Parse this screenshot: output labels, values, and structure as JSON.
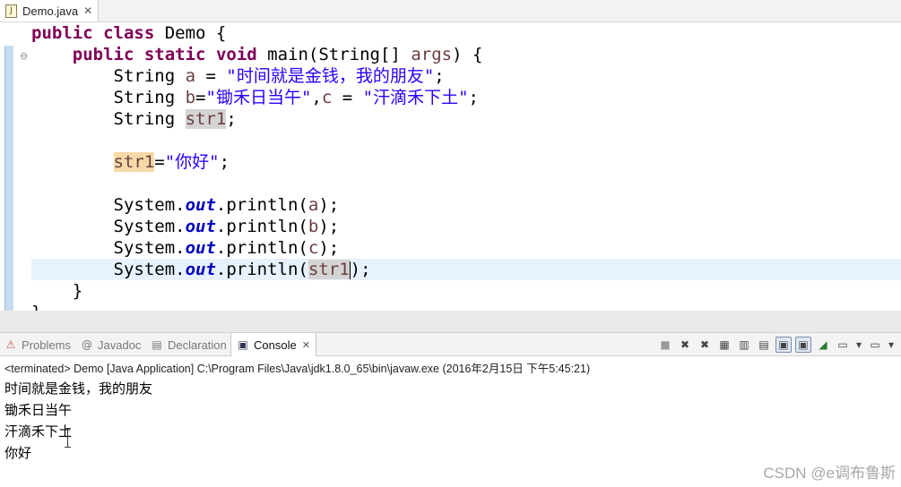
{
  "editor_tab": {
    "icon": "java-file-icon",
    "title": "Demo.java",
    "close": "✕"
  },
  "code": {
    "l1": {
      "kw1": "public",
      "kw2": "class",
      "rest": " Demo {"
    },
    "l2": {
      "indent": "    ",
      "kw1": "public",
      "kw2": "static",
      "kw3": "void",
      "rest1": " main(String[] ",
      "arg": "args",
      "rest2": ") {"
    },
    "l3": {
      "indent": "        ",
      "t1": "String ",
      "var": "a",
      "t2": " = ",
      "str": "\"时间就是金钱，我的朋友\"",
      "t3": ";"
    },
    "l4": {
      "indent": "        ",
      "t1": "String ",
      "var1": "b",
      "t2": "=",
      "str1": "\"锄禾日当午\"",
      "t3": ",",
      "var2": "c",
      "t4": " = ",
      "str2": "\"汗滴禾下土\"",
      "t5": ";"
    },
    "l5": {
      "indent": "        ",
      "t1": "String ",
      "var": "str1",
      "t2": ";"
    },
    "l6": {
      "indent": "        ",
      "var": "str1",
      "t1": "=",
      "str": "\"你好\"",
      "t2": ";"
    },
    "l7": {
      "indent": "        ",
      "t1": "System.",
      "fld": "out",
      "t2": ".println(",
      "var": "a",
      "t3": ");"
    },
    "l8": {
      "indent": "        ",
      "t1": "System.",
      "fld": "out",
      "t2": ".println(",
      "var": "b",
      "t3": ");"
    },
    "l9": {
      "indent": "        ",
      "t1": "System.",
      "fld": "out",
      "t2": ".println(",
      "var": "c",
      "t3": ");"
    },
    "l10": {
      "indent": "        ",
      "t1": "System.",
      "fld": "out",
      "t2": ".println(",
      "var": "str1",
      "t3": ");"
    },
    "l11": {
      "text": "    }"
    },
    "l12": {
      "text": "}"
    }
  },
  "views": {
    "problems": {
      "icon": "problems-icon",
      "label": "Problems"
    },
    "javadoc": {
      "icon": "javadoc-icon",
      "label": "Javadoc"
    },
    "declaration": {
      "icon": "declaration-icon",
      "label": "Declaration"
    },
    "console": {
      "icon": "console-icon",
      "label": "Console",
      "close": "✕"
    }
  },
  "console": {
    "status": "<terminated> Demo [Java Application] C:\\Program Files\\Java\\jdk1.8.0_65\\bin\\javaw.exe (2016年2月15日 下午5:45:21)",
    "output": [
      "时间就是金钱，我的朋友",
      "锄禾日当午",
      "汗滴禾下土",
      "你好"
    ]
  },
  "watermark": "CSDN @e调布鲁斯"
}
